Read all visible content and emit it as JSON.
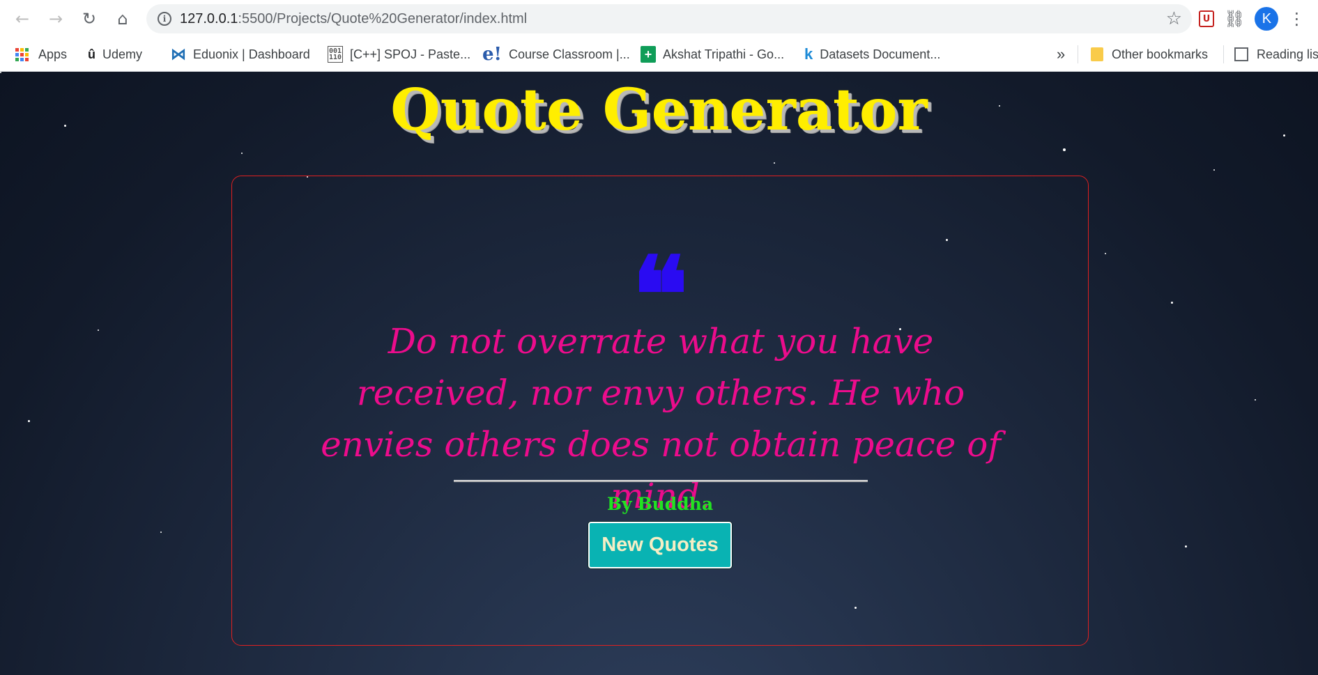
{
  "browser": {
    "url_host": "127.0.0.1",
    "url_path": ":5500/Projects/Quote%20Generator/index.html",
    "avatar_letter": "K",
    "extension_badge": "U"
  },
  "bookmarks": {
    "apps": "Apps",
    "items": [
      {
        "label": "Udemy",
        "icon": "udemy-icon",
        "color": "#a435f0"
      },
      {
        "label": "Eduonix | Dashboard",
        "icon": "eduonix-icon",
        "color": "#1f6fb5"
      },
      {
        "label": "[C++] SPOJ - Paste...",
        "icon": "spoj-icon",
        "color": "#555555"
      },
      {
        "label": "Course Classroom |...",
        "icon": "e-icon",
        "color": "#2a5bab"
      },
      {
        "label": "Akshat Tripathi - Go...",
        "icon": "sheets-icon",
        "color": "#0f9d58"
      },
      {
        "label": "Datasets Document...",
        "icon": "k-icon",
        "color": "#1c8ad6"
      }
    ],
    "overflow": "»",
    "other": "Other bookmarks",
    "reading": "Reading lis"
  },
  "page": {
    "title": "Quote Generator",
    "quote_mark": "❝",
    "quote": "Do not overrate what you have received, nor envy others. He who envies others does not obtain peace of mind.",
    "author_prefix": "By",
    "author": "Buddha",
    "button_label": "New Quotes"
  },
  "colors": {
    "title": "#ffee00",
    "quote_text": "#ec0c8c",
    "quote_mark": "#2a0bf2",
    "author": "#22e222",
    "button_bg": "#09b3b3",
    "card_border": "#e02020"
  }
}
